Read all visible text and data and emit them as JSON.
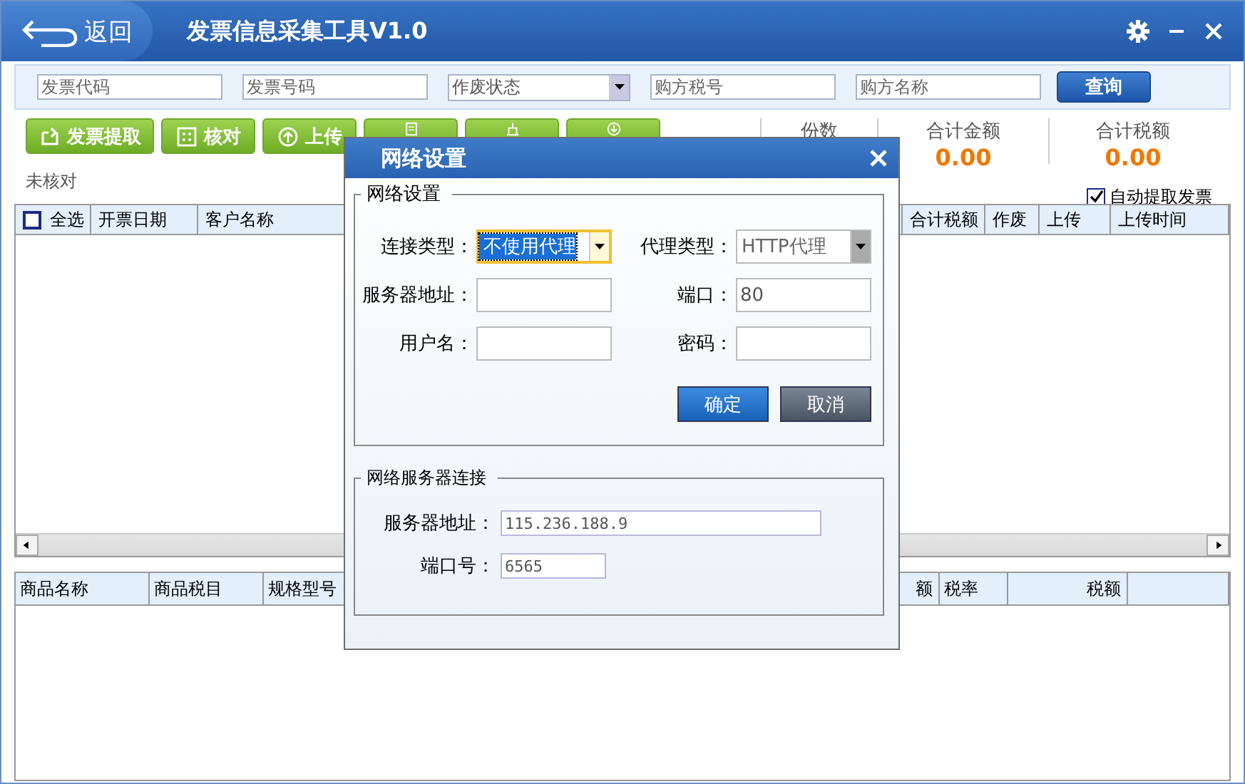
{
  "app": {
    "back": "返回",
    "title": "发票信息采集工具V1.0"
  },
  "search": {
    "fields": [
      {
        "kind": "text",
        "placeholder": "发票代码"
      },
      {
        "kind": "text",
        "placeholder": "发票号码"
      },
      {
        "kind": "select",
        "value": "作废状态"
      },
      {
        "kind": "text",
        "placeholder": "购方税号"
      },
      {
        "kind": "text",
        "placeholder": "购方名称"
      }
    ],
    "button": "查询"
  },
  "toolbar": [
    {
      "kind": "extract",
      "label": "发票提取"
    },
    {
      "kind": "check",
      "label": "核对"
    },
    {
      "kind": "upload",
      "label": "上传"
    },
    {
      "kind": "log"
    },
    {
      "kind": "clear"
    },
    {
      "kind": "export"
    }
  ],
  "stats": [
    {
      "label": "份数"
    },
    {
      "label": "合计金额",
      "value": "0.00"
    },
    {
      "label": "合计税额",
      "value": "0.00"
    }
  ],
  "status_text": "未核对",
  "auto_extract": {
    "label": "自动提取发票",
    "checked": true
  },
  "invoice_table": {
    "select_all": {
      "label": "全选",
      "checked": false
    },
    "columns": [
      "开票日期",
      "客户名称",
      "合计税额",
      "作废",
      "上传",
      "上传时间"
    ]
  },
  "item_table": {
    "columns": [
      "商品名称",
      "商品税目",
      "规格型号",
      "额",
      "税率",
      "税额"
    ]
  },
  "dialog": {
    "title": "网络设置",
    "proxy_group": {
      "title": "网络设置",
      "fields": [
        {
          "kind": "select",
          "label": "连接类型：",
          "value": "不使用代理",
          "focused": true,
          "disabled": false
        },
        {
          "kind": "select",
          "label": "代理类型：",
          "value": "HTTP代理",
          "focused": false,
          "disabled": true
        },
        {
          "kind": "text",
          "label": "服务器地址：",
          "focused": false,
          "disabled": false
        },
        {
          "kind": "text",
          "label": "端口：",
          "value": "80",
          "focused": false,
          "disabled": false
        },
        {
          "kind": "text",
          "label": "用户名：",
          "focused": false,
          "disabled": false
        },
        {
          "kind": "text",
          "label": "密码：",
          "focused": false,
          "disabled": false
        }
      ],
      "buttons": [
        {
          "kind": "primary",
          "label": "确定"
        },
        {
          "kind": "secondary",
          "label": "取消"
        }
      ]
    },
    "server_group": {
      "title": "网络服务器连接",
      "fields": [
        {
          "label": "服务器地址：",
          "value": "115.236.188.9"
        },
        {
          "label": "端口号：",
          "value": "6565"
        }
      ]
    }
  }
}
